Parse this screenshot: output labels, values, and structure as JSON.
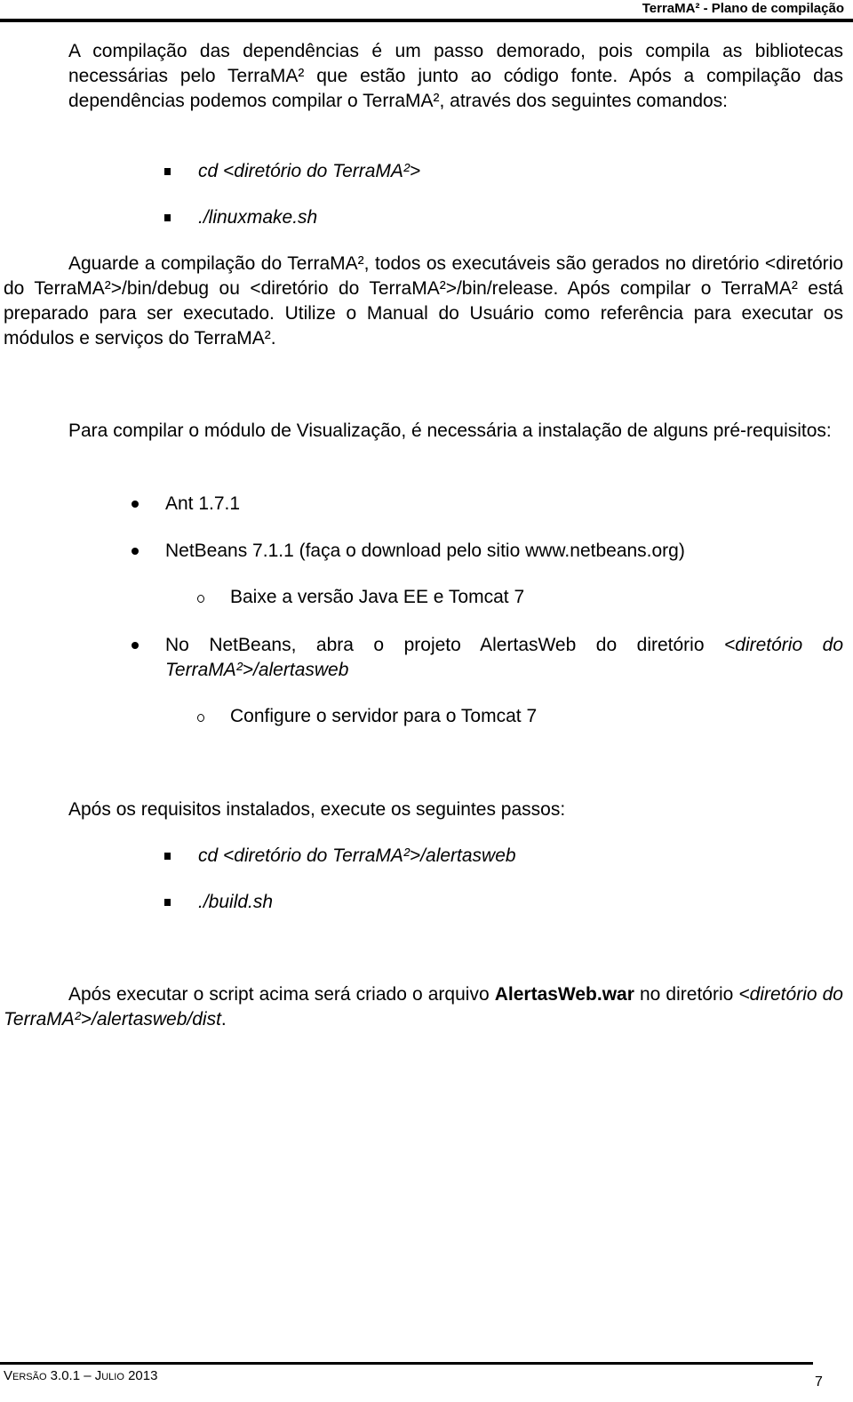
{
  "header": {
    "title": "TerraMA² - Plano de compilação"
  },
  "intro": {
    "text": "A compilação das dependências é um passo demorado, pois compila as bibliotecas necessárias pelo TerraMA² que estão junto ao código fonte. Após a compilação das dependências podemos compilar o TerraMA², através dos seguintes comandos:"
  },
  "commands_1": [
    "cd <diretório do TerraMA²>",
    "./linuxmake.sh"
  ],
  "wait_paragraph": {
    "text": "Aguarde a compilação do TerraMA², todos os executáveis são gerados no diretório <diretório do TerraMA²>/bin/debug ou <diretório do TerraMA²>/bin/release. Após compilar o TerraMA² está preparado para ser executado. Utilize o Manual do Usuário como referência para executar os módulos e serviços do TerraMA²."
  },
  "visualization_paragraph": {
    "text": "Para compilar o módulo de Visualização, é necessária a instalação de alguns pré-requisitos:"
  },
  "prerequisites": [
    {
      "text": "Ant 1.7.1"
    },
    {
      "text": "NetBeans 7.1.1 (faça o download pelo sitio www.netbeans.org)",
      "sub": "Baixe a versão Java EE e Tomcat 7"
    },
    {
      "text_plain": "No NetBeans, abra o projeto AlertasWeb do diretório ",
      "text_italic": "<diretório do TerraMA²>/alertasweb",
      "sub": "Configure o servidor para o Tomcat 7"
    }
  ],
  "steps_paragraph": {
    "text": "Após os requisitos instalados, execute os seguintes passos:"
  },
  "commands_2": [
    "cd <diretório do TerraMA²>/alertasweb",
    "./build.sh"
  ],
  "final_paragraph": {
    "part1": "Após executar o script acima será criado o arquivo ",
    "bold": "AlertasWeb.war",
    "part2": " no diretório ",
    "italic": "<diretório do TerraMA²>/alertasweb/dist",
    "end": "."
  },
  "footer": {
    "version": "Versão 3.0.1 – Julio 2013",
    "page_number": "7"
  }
}
